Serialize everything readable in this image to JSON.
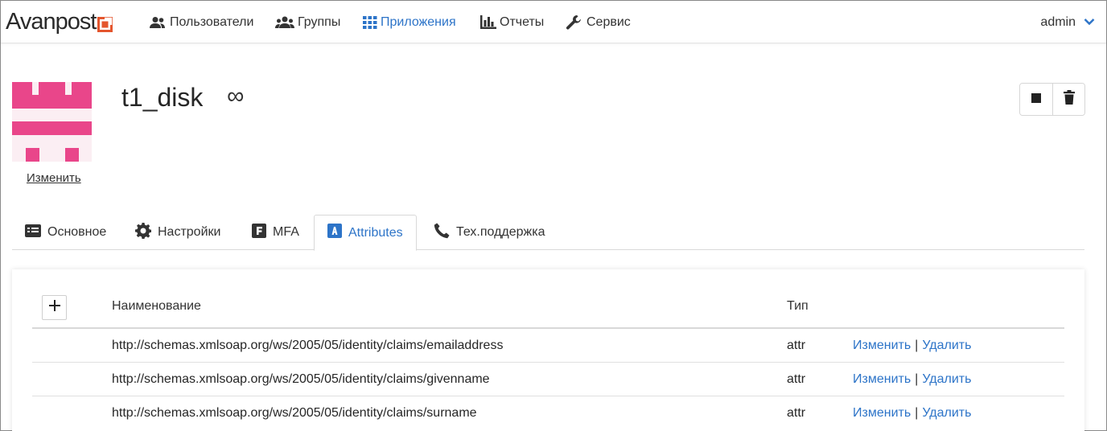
{
  "brand": {
    "name": "Avanpost",
    "accent": "#e4552d"
  },
  "nav": {
    "items": [
      {
        "label": "Пользователи",
        "icon": "users-icon"
      },
      {
        "label": "Группы",
        "icon": "group-icon"
      },
      {
        "label": "Приложения",
        "icon": "apps-grid-icon",
        "active": true
      },
      {
        "label": "Отчеты",
        "icon": "bar-chart-icon"
      },
      {
        "label": "Сервис",
        "icon": "wrench-icon"
      }
    ],
    "user": "admin"
  },
  "app": {
    "title": "t1_disk",
    "avatar_edit_label": "Изменить",
    "avatar_color": "#e9468a"
  },
  "tabs": [
    {
      "label": "Основное",
      "icon": "id-card-icon"
    },
    {
      "label": "Настройки",
      "icon": "gear-icon"
    },
    {
      "label": "MFA",
      "icon": "mfa-icon"
    },
    {
      "label": "Attributes",
      "icon": "attributes-icon",
      "active": true
    },
    {
      "label": "Тех.поддержка",
      "icon": "phone-icon"
    }
  ],
  "table": {
    "columns": {
      "name": "Наименование",
      "type": "Тип"
    },
    "rows": [
      {
        "name": "http://schemas.xmlsoap.org/ws/2005/05/identity/claims/emailaddress",
        "type": "attr",
        "edit": "Изменить",
        "delete": "Удалить"
      },
      {
        "name": "http://schemas.xmlsoap.org/ws/2005/05/identity/claims/givenname",
        "type": "attr",
        "edit": "Изменить",
        "delete": "Удалить"
      },
      {
        "name": "http://schemas.xmlsoap.org/ws/2005/05/identity/claims/surname",
        "type": "attr",
        "edit": "Изменить",
        "delete": "Удалить"
      }
    ],
    "separator": "|"
  },
  "colors": {
    "link": "#2d74c8",
    "active": "#2d74c8"
  }
}
